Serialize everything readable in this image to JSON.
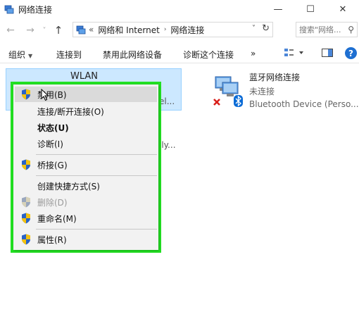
{
  "window": {
    "title": "网络连接",
    "minimize": "—",
    "maximize": "☐",
    "close": "✕"
  },
  "address": {
    "back": "←",
    "forward": "→",
    "recent": "˅",
    "up": "↑",
    "overflow": "«",
    "crumbs": [
      "网络和 Internet",
      "网络连接"
    ],
    "crumb_sep": "›",
    "dropdown": "˅",
    "refresh": "↻",
    "search_placeholder": "搜索\"网络...",
    "search_icon": "⚲"
  },
  "toolbar": {
    "organize": "组织",
    "connect_to": "连接到",
    "disable_device": "禁用此网络设备",
    "diagnose": "诊断这个连接",
    "more": "»",
    "help": "?"
  },
  "connections": {
    "wlan": {
      "name": "WLAN",
      "sub_partial": "el...",
      "sub_partial2": "ily..."
    },
    "bluetooth": {
      "name": "蓝牙网络连接",
      "status": "未连接",
      "device": "Bluetooth Device (Perso..."
    }
  },
  "context_menu": {
    "items": [
      {
        "label": "禁用(B)",
        "shield": true
      },
      {
        "label": "连接/断开连接(O)",
        "shield": false
      },
      {
        "label": "状态(U)",
        "shield": false,
        "bold": true
      },
      {
        "label": "诊断(I)",
        "shield": false
      },
      {
        "label": "桥接(G)",
        "shield": true
      },
      {
        "label": "创建快捷方式(S)",
        "shield": false
      },
      {
        "label": "删除(D)",
        "shield": true,
        "disabled": true
      },
      {
        "label": "重命名(M)",
        "shield": true
      },
      {
        "label": "属性(R)",
        "shield": true
      }
    ]
  },
  "colors": {
    "highlight_border": "#22e022",
    "selection_bg": "#cce8ff",
    "shield_blue": "#2a63c7",
    "shield_yellow": "#f4c20d",
    "bt_blue": "#0a6bd6",
    "error_red": "#d9201b"
  }
}
